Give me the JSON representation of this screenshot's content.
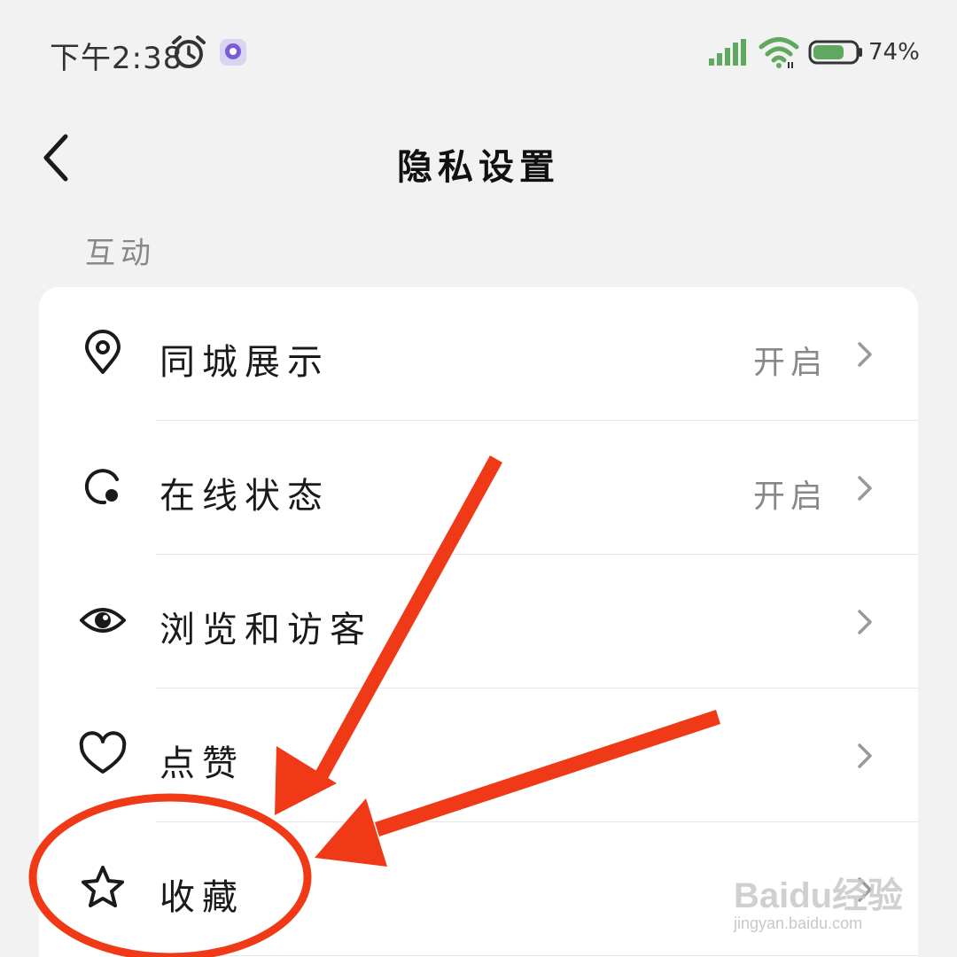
{
  "status_bar": {
    "time": "下午2:38",
    "battery_percent_label": "74%",
    "battery_level": 0.74,
    "icons": [
      "alarm-icon",
      "app-notification-icon",
      "signal-icon",
      "wifi-icon",
      "battery-icon"
    ]
  },
  "header": {
    "title": "隐私设置",
    "back_icon": "chevron-left-icon"
  },
  "section": {
    "label": "互动"
  },
  "rows": [
    {
      "label": "同城展示",
      "value": "开启",
      "icon": "location-pin-icon"
    },
    {
      "label": "在线状态",
      "value": "开启",
      "icon": "online-status-icon"
    },
    {
      "label": "浏览和访客",
      "value": "",
      "icon": "eye-icon"
    },
    {
      "label": "点赞",
      "value": "",
      "icon": "heart-icon"
    },
    {
      "label": "收藏",
      "value": "",
      "icon": "star-icon"
    }
  ],
  "annotation": {
    "color": "#f03a17",
    "type": "arrows-and-circle"
  },
  "watermark": {
    "logo": "Baidu经验",
    "url": "jingyan.baidu.com"
  },
  "colors": {
    "background": "#f2f2f2",
    "card": "#ffffff",
    "signal_green": "#5fa85f",
    "annotation_red": "#f03a17"
  }
}
